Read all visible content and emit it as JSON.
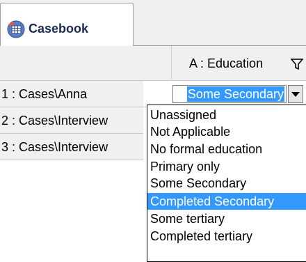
{
  "tab": {
    "label": "Casebook",
    "icon": "casebook-icon"
  },
  "column": {
    "title": "A : Education",
    "filter_icon": "filter-icon"
  },
  "rows": [
    {
      "label": "1 : Cases\\Anna"
    },
    {
      "label": "2 : Cases\\Interview"
    },
    {
      "label": "3 : Cases\\Interview"
    }
  ],
  "editor": {
    "value": "Some Secondary"
  },
  "dropdown": {
    "options": [
      "Unassigned",
      "Not Applicable",
      "No formal education",
      "Primary only",
      "Some Secondary",
      "Completed Secondary",
      "Some tertiary",
      "Completed tertiary"
    ],
    "highlighted": "Completed Secondary"
  },
  "colors": {
    "selection": "#3399ff",
    "tab_text": "#1b2a55"
  }
}
